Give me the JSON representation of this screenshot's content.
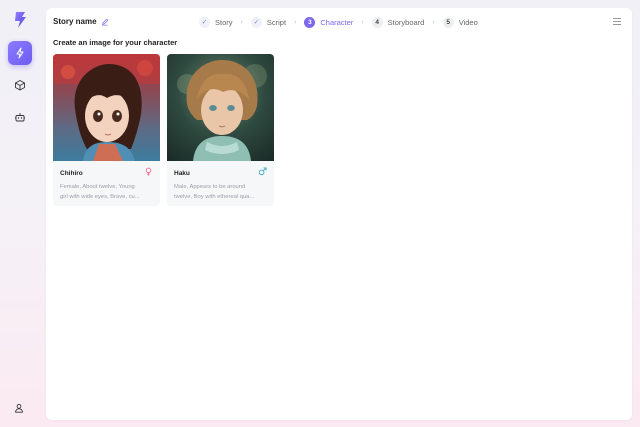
{
  "sidebar": {
    "logo": "lightning-logo-icon",
    "nav": [
      {
        "icon": "lightning-icon",
        "active": true
      },
      {
        "icon": "cube-icon",
        "active": false
      },
      {
        "icon": "robot-icon",
        "active": false
      }
    ],
    "footer_icon": "user-icon"
  },
  "header": {
    "story_name": "Story name",
    "edit_icon": "pencil-icon",
    "steps": [
      {
        "marker": "✓",
        "label": "Story",
        "state": "done"
      },
      {
        "marker": "✓",
        "label": "Script",
        "state": "done"
      },
      {
        "marker": "3",
        "label": "Character",
        "state": "current"
      },
      {
        "marker": "4",
        "label": "Storyboard",
        "state": "todo"
      },
      {
        "marker": "5",
        "label": "Video",
        "state": "todo"
      }
    ],
    "separator": "›",
    "menu_icon": "menu-icon"
  },
  "main": {
    "heading": "Create an image for your character",
    "characters": [
      {
        "name": "Chihiro",
        "gender": "female",
        "gender_icon": "female-symbol-icon",
        "desc_line1": "Female, About twelve, Young",
        "desc_line2": "girl with wide eyes, Brave, cu..."
      },
      {
        "name": "Haku",
        "gender": "male",
        "gender_icon": "male-symbol-icon",
        "desc_line1": "Male, Appears to be around",
        "desc_line2": "twelve, Boy with ethereal qua..."
      }
    ]
  },
  "colors": {
    "accent": "#7b68ee",
    "female": "#f06a8a",
    "male": "#3aa8c8"
  }
}
